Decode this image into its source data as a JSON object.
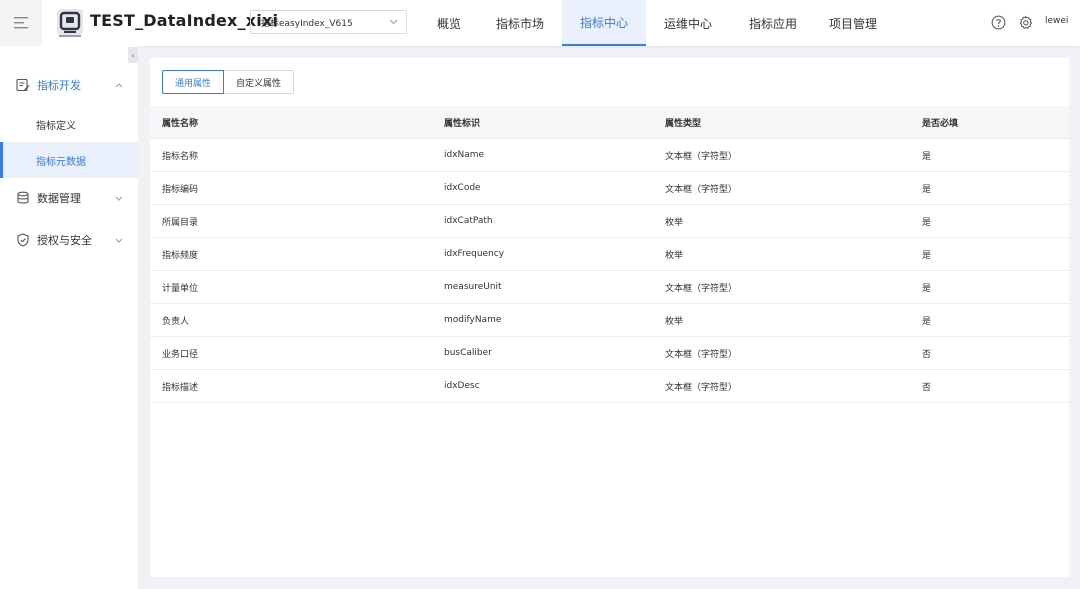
{
  "header": {
    "app_title": "TEST_DataIndex_xixi",
    "project_select": "指标easyIndex_V615",
    "nav": [
      "概览",
      "指标市场",
      "指标中心",
      "运维中心",
      "指标应用",
      "项目管理"
    ],
    "active_nav": "指标中心",
    "user": "lewei"
  },
  "sidebar": {
    "groups": [
      {
        "label": "指标开发",
        "icon": "chart-doc-icon",
        "expanded": true,
        "items": [
          {
            "label": "指标定义"
          },
          {
            "label": "指标元数据"
          }
        ]
      },
      {
        "label": "数据管理",
        "icon": "database-icon",
        "expanded": false
      },
      {
        "label": "授权与安全",
        "icon": "shield-icon",
        "expanded": false
      }
    ],
    "active_item": "指标元数据"
  },
  "tabs": {
    "general": "通用属性",
    "custom": "自定义属性",
    "active": "通用属性"
  },
  "table": {
    "columns": [
      "属性名称",
      "属性标识",
      "属性类型",
      "是否必填"
    ],
    "rows": [
      [
        "指标名称",
        "idxName",
        "文本框（字符型）",
        "是"
      ],
      [
        "指标编码",
        "idxCode",
        "文本框（字符型）",
        "是"
      ],
      [
        "所属目录",
        "idxCatPath",
        "枚举",
        "是"
      ],
      [
        "指标频度",
        "idxFrequency",
        "枚举",
        "是"
      ],
      [
        "计量单位",
        "measureUnit",
        "文本框（字符型）",
        "是"
      ],
      [
        "负责人",
        "modifyName",
        "枚举",
        "是"
      ],
      [
        "业务口径",
        "busCaliber",
        "文本框（字符型）",
        "否"
      ],
      [
        "指标描述",
        "idxDesc",
        "文本框（字符型）",
        "否"
      ]
    ]
  },
  "colors": {
    "accent": "#3a7bdc",
    "active_bg": "#e9f0fb",
    "page_bg": "#f0f2f5"
  }
}
